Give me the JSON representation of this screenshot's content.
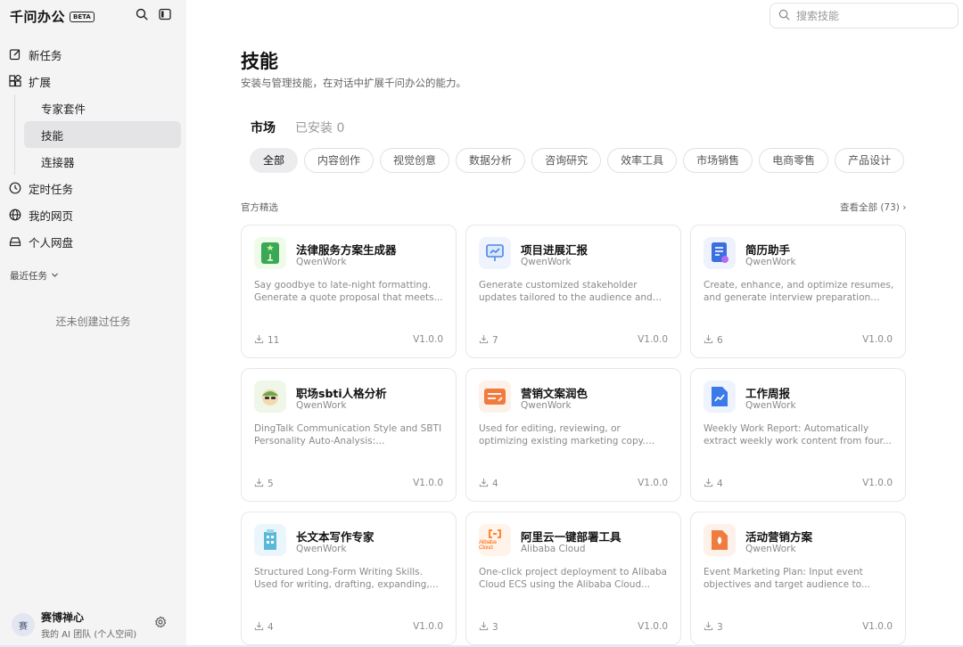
{
  "app": {
    "name": "千问办公",
    "badge": "BETA"
  },
  "sidebar": {
    "items": [
      {
        "label": "新任务",
        "icon": "edit-icon"
      },
      {
        "label": "扩展",
        "icon": "grid-icon"
      }
    ],
    "sub_items": [
      {
        "label": "专家套件"
      },
      {
        "label": "技能",
        "active": true
      },
      {
        "label": "连接器"
      }
    ],
    "more_items": [
      {
        "label": "定时任务",
        "icon": "clock-icon"
      },
      {
        "label": "我的网页",
        "icon": "globe-icon"
      },
      {
        "label": "个人网盘",
        "icon": "drive-icon"
      }
    ],
    "recent_label": "最近任务",
    "empty_text": "还未创建过任务",
    "user": {
      "avatar": "赛",
      "name": "赛博禅心",
      "team": "我的 AI 团队 (个人空间)"
    }
  },
  "search": {
    "placeholder": "搜索技能"
  },
  "page": {
    "title": "技能",
    "subtitle": "安装与管理技能，在对话中扩展千问办公的能力。"
  },
  "tabs": [
    {
      "label": "市场",
      "active": true
    },
    {
      "label": "已安装 0",
      "active": false
    }
  ],
  "chips": [
    "全部",
    "内容创作",
    "视觉创意",
    "数据分析",
    "咨询研究",
    "效率工具",
    "市场销售",
    "电商零售",
    "产品设计"
  ],
  "section": {
    "label": "官方精选",
    "view_all": "查看全部 (73) ›"
  },
  "cards": [
    {
      "name": "法律服务方案生成器",
      "author": "QwenWork",
      "desc": "Say goodbye to late-night formatting. Generate a quote proposal that meets...",
      "downloads": "11",
      "version": "V1.0.0",
      "icon": "legal-doc-icon",
      "color": "#3aa856"
    },
    {
      "name": "项目进展汇报",
      "author": "QwenWork",
      "desc": "Generate customized stakeholder updates tailored to the audience and frequency....",
      "downloads": "7",
      "version": "V1.0.0",
      "icon": "presentation-icon",
      "color": "#4a86e8"
    },
    {
      "name": "简历助手",
      "author": "QwenWork",
      "desc": "Create, enhance, and optimize resumes, and generate interview preparation plan...",
      "downloads": "6",
      "version": "V1.0.0",
      "icon": "resume-icon",
      "color": "#3b6fe0"
    },
    {
      "name": "职场sbti人格分析",
      "author": "QwenWork",
      "desc": "DingTalk Communication Style and SBTI Personality Auto-Analysis: Automatically...",
      "downloads": "5",
      "version": "V1.0.0",
      "icon": "person-icon",
      "color": "#6aa84f"
    },
    {
      "name": "营销文案润色",
      "author": "QwenWork",
      "desc": "Used for editing, reviewing, or optimizing existing marketing copy. Suitable for...",
      "downloads": "4",
      "version": "V1.0.0",
      "icon": "card-edit-icon",
      "color": "#f07b3f"
    },
    {
      "name": "工作周报",
      "author": "QwenWork",
      "desc": "Weekly Work Report: Automatically extract weekly work content from four...",
      "downloads": "4",
      "version": "V1.0.0",
      "icon": "report-chart-icon",
      "color": "#3b7be8"
    },
    {
      "name": "长文本写作专家",
      "author": "QwenWork",
      "desc": "Structured Long-Form Writing Skills. Used for writing, drafting, expanding,...",
      "downloads": "4",
      "version": "V1.0.0",
      "icon": "building-icon",
      "color": "#5ab8d8"
    },
    {
      "name": "阿里云一键部署工具",
      "author": "Alibaba Cloud",
      "desc": "One-click project deployment to Alibaba Cloud ECS using the Alibaba Cloud...",
      "downloads": "3",
      "version": "V1.0.0",
      "icon": "alibaba-cloud-logo",
      "logo_text": "Alibaba Cloud",
      "color": "#ff6a00"
    },
    {
      "name": "活动营销方案",
      "author": "QwenWork",
      "desc": "Event Marketing Plan: Input event objectives and target audience to...",
      "downloads": "3",
      "version": "V1.0.0",
      "icon": "file-fire-icon",
      "color": "#f07b3f"
    }
  ]
}
